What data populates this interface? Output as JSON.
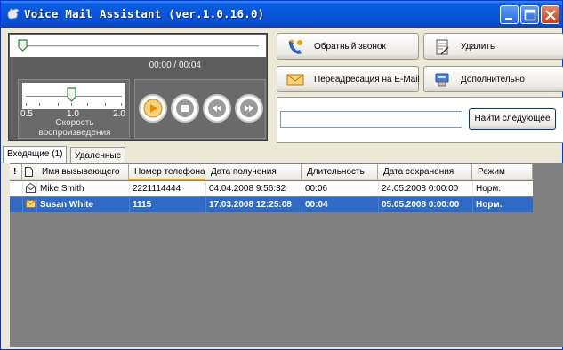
{
  "window": {
    "title": "Voice Mail Assistant (ver.1.0.16.0)",
    "icons": {
      "app": "app-logo-icon",
      "minimize": "minimize-icon",
      "maximize": "maximize-icon",
      "close": "close-icon"
    }
  },
  "player": {
    "time": "00:00 / 00:04",
    "progress": 0,
    "speed": {
      "value": 1.0,
      "min_label": "0.5",
      "mid_label": "1.0",
      "max_label": "2.0",
      "caption_line1": "Скорость",
      "caption_line2": "воспроизведения"
    },
    "controls": [
      "play-icon",
      "stop-icon",
      "rewind-icon",
      "forward-icon"
    ]
  },
  "actions": {
    "callback": "Обратный звонок",
    "delete": "Удалить",
    "forward_email": "Переадресация на E-Mail",
    "more": "Дополнительно",
    "find_next": "Найти следующее",
    "search_value": ""
  },
  "tabs": [
    {
      "label": "Входящие (1)",
      "active": true
    },
    {
      "label": "Удаленные",
      "active": false
    }
  ],
  "table": {
    "headers": {
      "flag": "!",
      "caller": "Имя вызывающего",
      "phone": "Номер телефона",
      "received": "Дата получения",
      "duration": "Длительность",
      "saved": "Дата сохранения",
      "mode": "Режим"
    },
    "sorted_column": "phone",
    "rows": [
      {
        "caller": "Mike Smith",
        "phone": "2221114444",
        "received": "04.04.2008 9:56:32",
        "duration": "00:06",
        "saved": "24.05.2008 0:00:00",
        "mode": "Норм.",
        "selected": false,
        "icon": "envelope-open-icon"
      },
      {
        "caller": "Susan White",
        "phone": "1115",
        "received": "17.03.2008 12:25:08",
        "duration": "00:04",
        "saved": "05.05.2008 0:00:00",
        "mode": "Норм.",
        "selected": true,
        "icon": "envelope-closed-icon"
      }
    ]
  },
  "colors": {
    "titlebar": "#0855dd",
    "selection": "#316ac5",
    "player_bg": "#5e5e5e",
    "play_accent": "#f0a000"
  }
}
